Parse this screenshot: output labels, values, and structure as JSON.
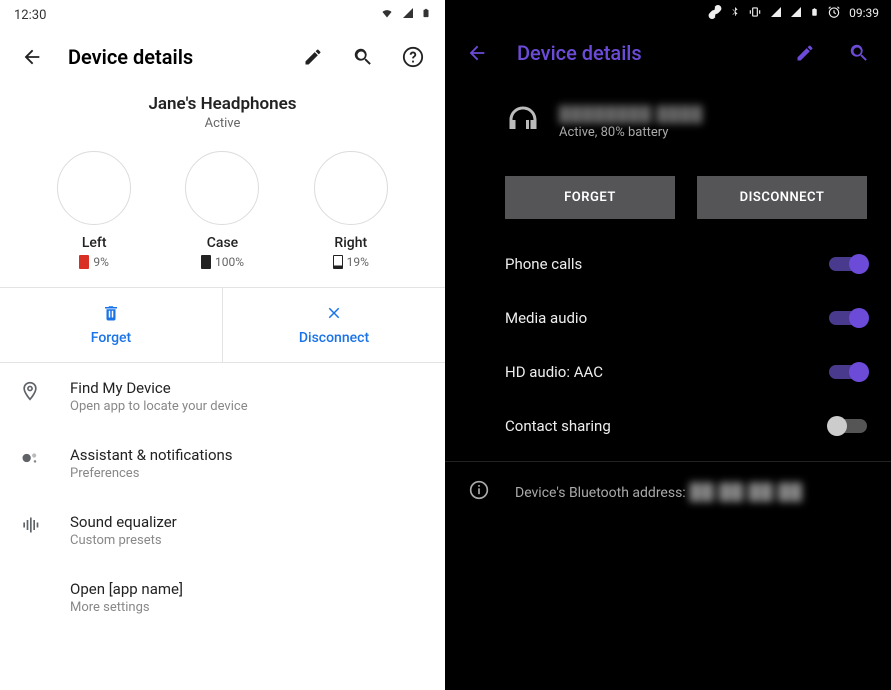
{
  "left": {
    "status": {
      "time": "12:30"
    },
    "title": "Device details",
    "device_name": "Jane's Headphones",
    "device_status": "Active",
    "battery": {
      "left": {
        "label": "Left",
        "pct": "9%"
      },
      "case": {
        "label": "Case",
        "pct": "100%"
      },
      "right": {
        "label": "Right",
        "pct": "19%"
      }
    },
    "actions": {
      "forget": "Forget",
      "disconnect": "Disconnect"
    },
    "settings": {
      "find": {
        "title": "Find My Device",
        "sub": "Open app to locate your device"
      },
      "assistant": {
        "title": "Assistant & notifications",
        "sub": "Preferences"
      },
      "eq": {
        "title": "Sound equalizer",
        "sub": "Custom presets"
      },
      "open": {
        "title": "Open [app name]",
        "sub": "More settings"
      }
    }
  },
  "right": {
    "status": {
      "time": "09:39"
    },
    "title": "Device details",
    "device_name": "████████ ████",
    "device_status": "Active, 80% battery",
    "actions": {
      "forget": "FORGET",
      "disconnect": "DISCONNECT"
    },
    "toggles": {
      "calls": {
        "label": "Phone calls",
        "on": true
      },
      "media": {
        "label": "Media audio",
        "on": true
      },
      "hd": {
        "label": "HD audio: AAC",
        "on": true
      },
      "contact": {
        "label": "Contact sharing",
        "on": false
      }
    },
    "bt_label": "Device's Bluetooth address:",
    "bt_addr": "██:██:██:██"
  }
}
